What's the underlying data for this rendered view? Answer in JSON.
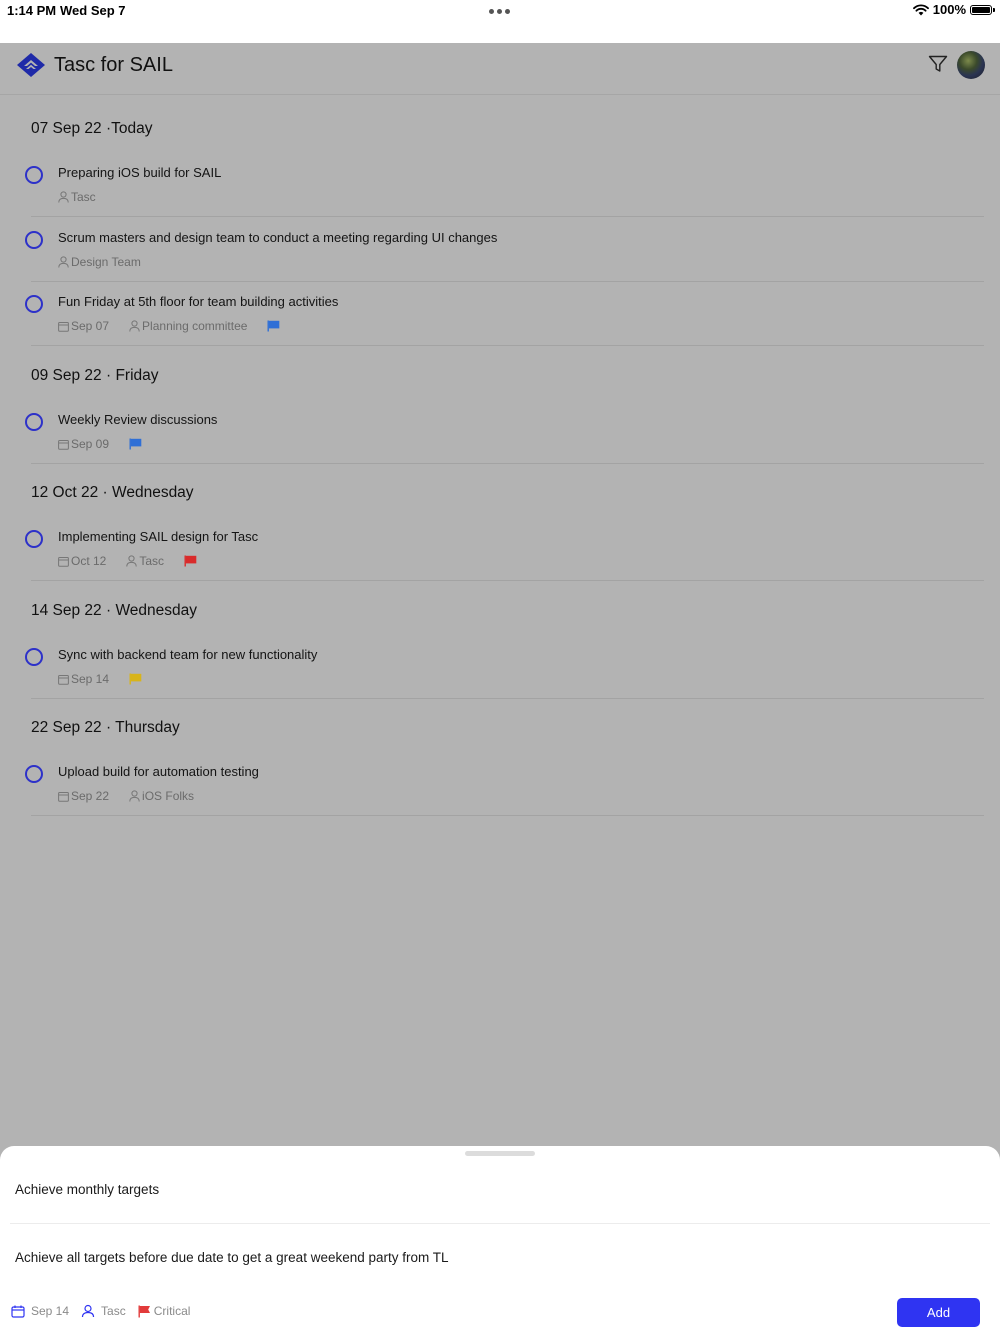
{
  "status_bar": {
    "time": "1:14 PM",
    "date": "Wed Sep 7",
    "battery": "100%",
    "icons": [
      "wifi-icon",
      "battery-icon"
    ]
  },
  "header": {
    "title": "Tasc for SAIL",
    "icons": [
      "sail-logo-icon",
      "filter-icon",
      "avatar"
    ]
  },
  "sections": [
    {
      "title": "07 Sep 22 ·Today",
      "tasks": [
        {
          "title": "Preparing iOS build for SAIL",
          "date": "",
          "assignee": "Tasc",
          "flag": ""
        },
        {
          "title": "Scrum masters and design team to conduct a meeting regarding UI changes",
          "date": "",
          "assignee": "Design Team",
          "flag": ""
        },
        {
          "title": "Fun Friday at 5th floor for team building activities",
          "date": "Sep 07",
          "assignee": "Planning committee",
          "flag": "#2f6fd6"
        }
      ]
    },
    {
      "title": "09 Sep 22 · Friday",
      "tasks": [
        {
          "title": "Weekly Review discussions",
          "date": "Sep 09",
          "assignee": "",
          "flag": "#2f6fd6"
        }
      ]
    },
    {
      "title": "12 Oct 22 · Wednesday",
      "tasks": [
        {
          "title": "Implementing SAIL design for Tasc",
          "date": "Oct 12",
          "assignee": "Tasc",
          "flag": "#d92b2b"
        }
      ]
    },
    {
      "title": "14 Sep 22 · Wednesday",
      "tasks": [
        {
          "title": "Sync with backend team for new functionality",
          "date": "Sep 14",
          "assignee": "",
          "flag": "#d8b41a"
        }
      ]
    },
    {
      "title": "22 Sep 22 · Thursday",
      "tasks": [
        {
          "title": "Upload build for automation testing",
          "date": "Sep 22",
          "assignee": "iOS Folks",
          "flag": ""
        }
      ]
    }
  ],
  "sheet": {
    "title": "Achieve monthly targets",
    "description": "Achieve all targets before due date to get a great weekend party from TL",
    "date": "Sep 14",
    "assignee": "Tasc",
    "priority": "Critical",
    "add_label": "Add"
  },
  "colors": {
    "accent": "#2f34f2",
    "checkbox": "#2d31c9",
    "overlay": "#b3b3b3",
    "flag_blue": "#2f6fd6",
    "flag_red": "#d92b2b",
    "flag_yellow": "#d8b41a"
  }
}
